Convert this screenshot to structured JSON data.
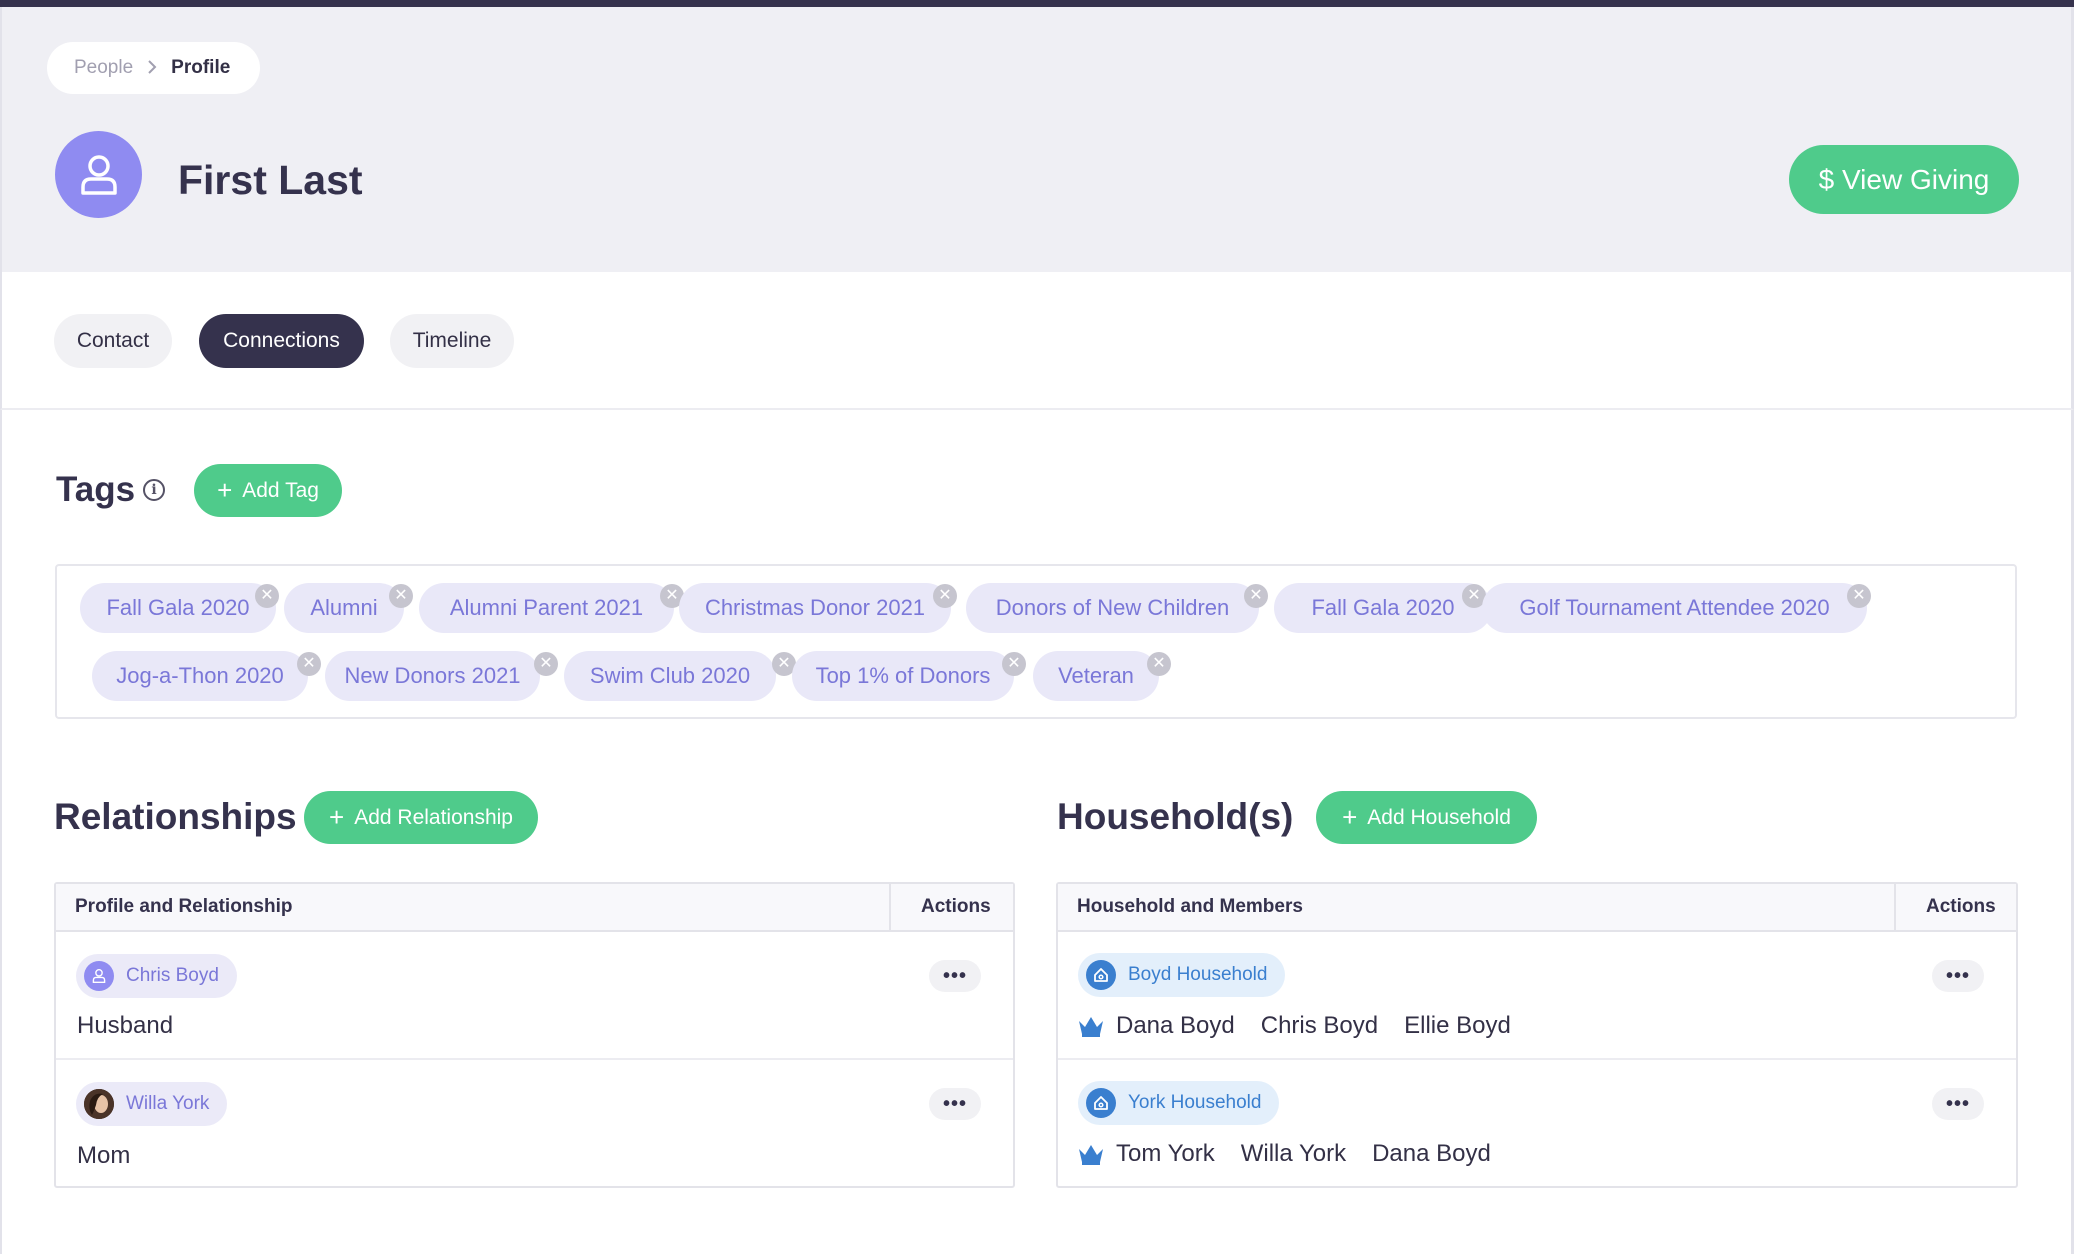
{
  "breadcrumb": {
    "parent": "People",
    "separator": ">",
    "current": "Profile"
  },
  "profile": {
    "name": "First Last"
  },
  "actions": {
    "view_giving": "$ View Giving"
  },
  "tabs": [
    {
      "label": "Contact",
      "active": false
    },
    {
      "label": "Connections",
      "active": true
    },
    {
      "label": "Timeline",
      "active": false
    }
  ],
  "tags_section": {
    "title": "Tags",
    "info_icon": "info-icon",
    "add_label": "Add Tag",
    "tags": [
      "Fall Gala 2020",
      "Alumni",
      "Alumni Parent 2021",
      "Christmas Donor 2021",
      "Donors of New Children",
      "Fall Gala 2020",
      "Golf Tournament Attendee 2020",
      "Jog-a-Thon 2020",
      "New Donors 2021",
      "Swim Club 2020",
      "Top 1% of Donors",
      "Veteran"
    ]
  },
  "relationships": {
    "title": "Relationships",
    "add_label": "Add Relationship",
    "col_profile": "Profile and Relationship",
    "col_actions": "Actions",
    "rows": [
      {
        "name": "Chris Boyd",
        "relation": "Husband",
        "avatar": "person-icon"
      },
      {
        "name": "Willa York",
        "relation": "Mom",
        "avatar": "photo-avatar"
      }
    ]
  },
  "households": {
    "title": "Household(s)",
    "add_label": "Add Household",
    "col_household": "Household and Members",
    "col_actions": "Actions",
    "rows": [
      {
        "name": "Boyd Household",
        "members": [
          "Dana Boyd",
          "Chris Boyd",
          "Ellie Boyd"
        ],
        "head_icon": "crown-icon"
      },
      {
        "name": "York Household",
        "members": [
          "Tom York",
          "Willa York",
          "Dana Boyd"
        ],
        "head_icon": "crown-icon"
      }
    ]
  },
  "more_actions_label": "•••",
  "colors": {
    "accent_green": "#4fcb8b",
    "dark": "#35324d",
    "tag_bg": "#e9e8f8",
    "tag_text": "#7a77d8",
    "household_blue": "#3a7fcf"
  }
}
